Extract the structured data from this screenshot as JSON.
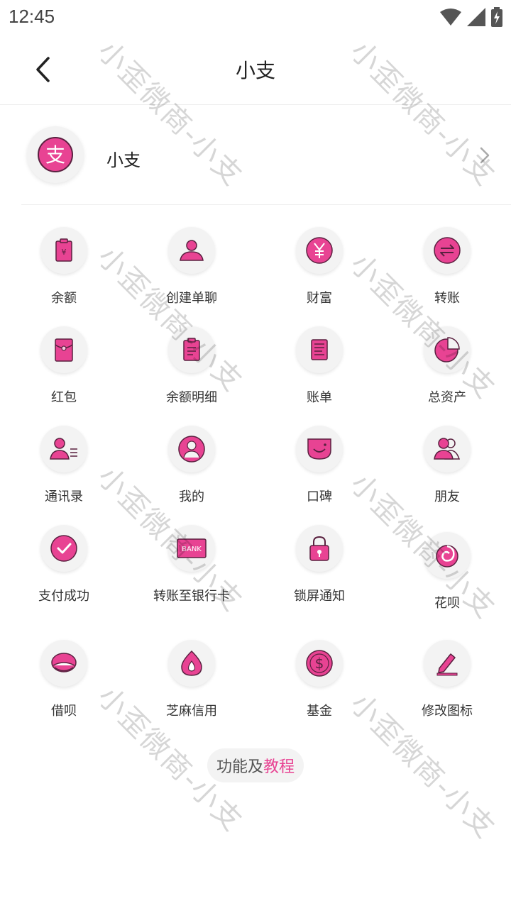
{
  "status": {
    "time": "12:45"
  },
  "header": {
    "title": "小支"
  },
  "profile": {
    "name": "小支",
    "avatar_glyph": "支"
  },
  "grid": [
    {
      "label": "余额",
      "icon": "balance-icon"
    },
    {
      "label": "创建单聊",
      "icon": "user-icon"
    },
    {
      "label": "财富",
      "icon": "yuan-icon"
    },
    {
      "label": "转账",
      "icon": "transfer-icon"
    },
    {
      "label": "红包",
      "icon": "red-packet-icon"
    },
    {
      "label": "余额明细",
      "icon": "clipboard-icon"
    },
    {
      "label": "账单",
      "icon": "bill-icon"
    },
    {
      "label": "总资产",
      "icon": "pie-icon"
    },
    {
      "label": "通讯录",
      "icon": "contacts-icon"
    },
    {
      "label": "我的",
      "icon": "profile-icon"
    },
    {
      "label": "口碑",
      "icon": "koubei-icon"
    },
    {
      "label": "朋友",
      "icon": "friends-icon"
    },
    {
      "label": "支付成功",
      "icon": "check-icon"
    },
    {
      "label": "转账至银行卡",
      "icon": "bank-card-icon",
      "badge": "BANK"
    },
    {
      "label": "锁屏通知",
      "icon": "lock-icon"
    },
    {
      "label": "花呗",
      "icon": "huabei-icon"
    },
    {
      "label": "借呗",
      "icon": "jiebei-icon"
    },
    {
      "label": "芝麻信用",
      "icon": "sesame-icon"
    },
    {
      "label": "基金",
      "icon": "dollar-icon"
    },
    {
      "label": "修改图标",
      "icon": "edit-icon"
    }
  ],
  "tutorial": {
    "part1": "功能及",
    "part2": "教程"
  },
  "watermark": "小歪微商-小支",
  "colors": {
    "accent": "#e84393",
    "icon_bg": "#f3f3f3",
    "icon_stroke": "#5a2140"
  }
}
